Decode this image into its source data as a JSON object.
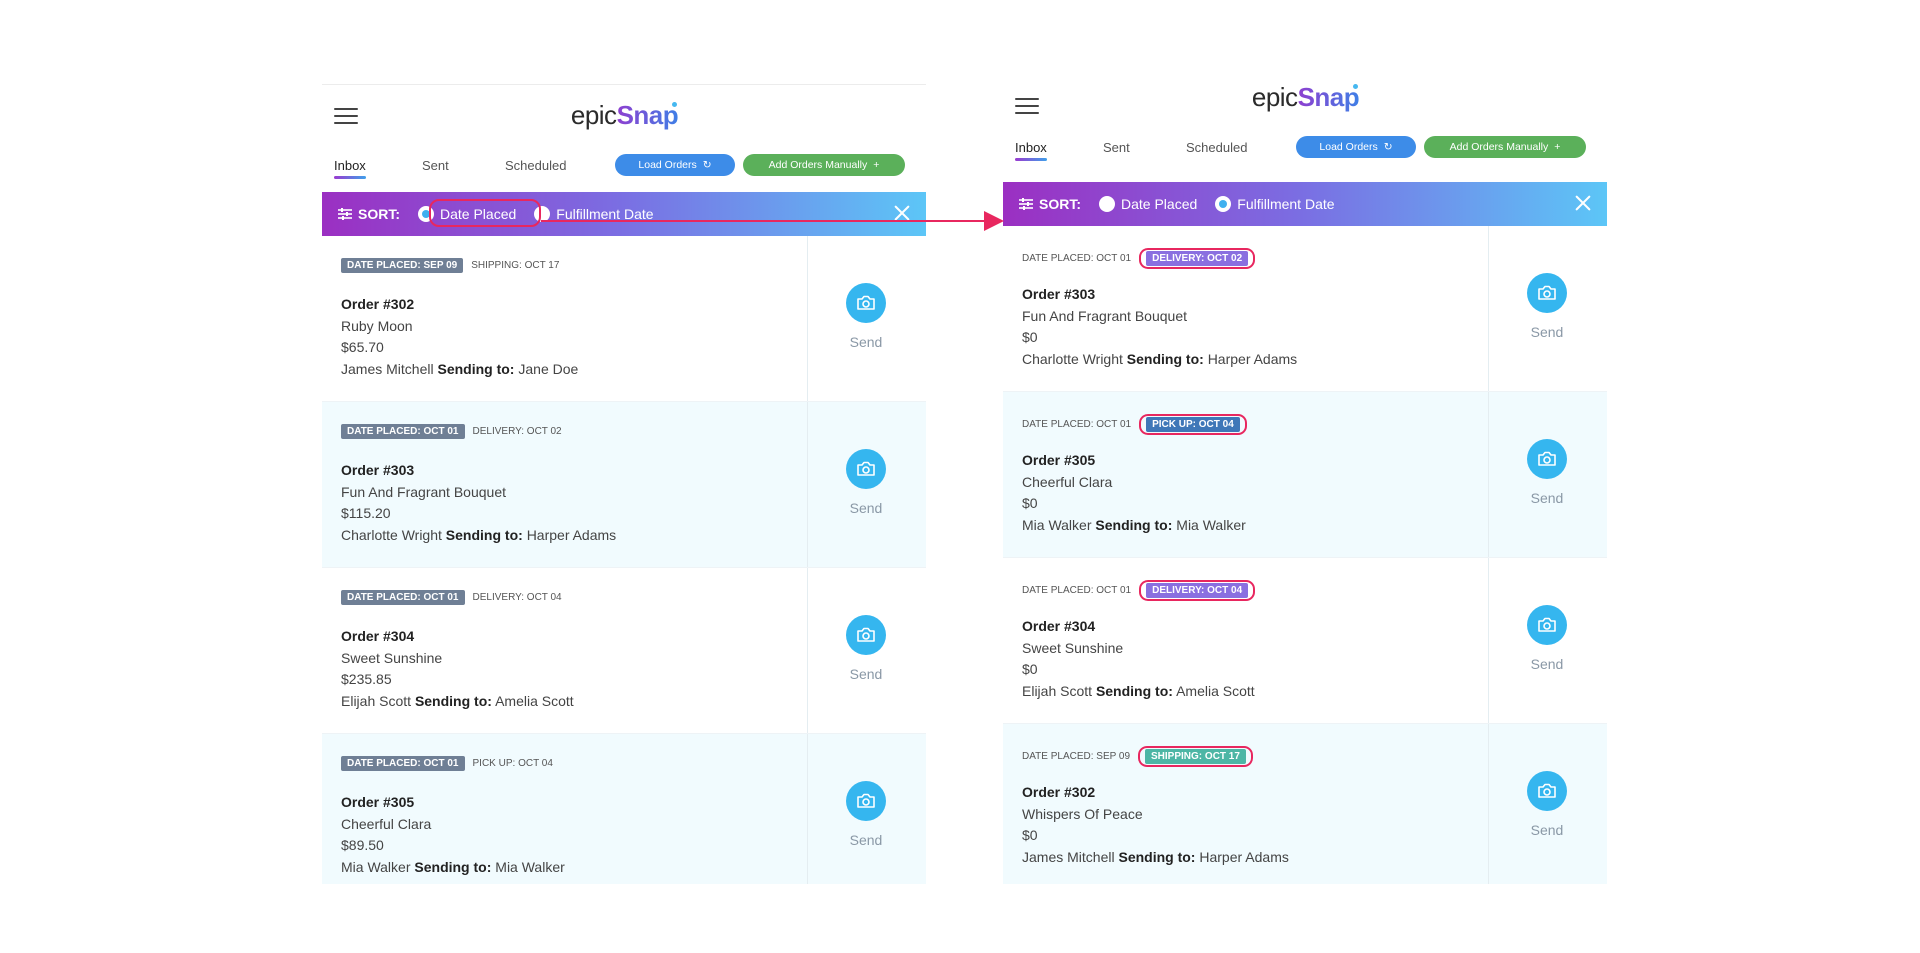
{
  "app": {
    "logo_epic": "epic",
    "logo_snap": "Snap"
  },
  "tabs": [
    {
      "label": "Inbox"
    },
    {
      "label": "Sent"
    },
    {
      "label": "Scheduled"
    }
  ],
  "buttons": {
    "load": "Load Orders",
    "add": "Add Orders Manually"
  },
  "sort": {
    "label": "SORT:",
    "option_date": "Date Placed",
    "option_fulfillment": "Fulfillment Date"
  },
  "send_label": "Send",
  "sending_to_label": "Sending to:",
  "colors": {
    "accent_purple": "#9b2fc2",
    "accent_blue": "#5cc6f7",
    "send_blue": "#35b6ef",
    "highlight": "#e8275f"
  },
  "left_panel": {
    "sort_selected": "date",
    "orders": [
      {
        "placed_badge": "DATE PLACED: SEP 09",
        "fulfillment": "SHIPPING: OCT 17",
        "order_no": "Order #302",
        "product": "Ruby Moon",
        "price": "$65.70",
        "sender": "James Mitchell",
        "recipient": "Jane Doe"
      },
      {
        "placed_badge": "DATE PLACED: OCT 01",
        "fulfillment": "DELIVERY: OCT 02",
        "order_no": "Order #303",
        "product": "Fun And Fragrant Bouquet",
        "price": "$115.20",
        "sender": "Charlotte Wright",
        "recipient": "Harper Adams"
      },
      {
        "placed_badge": "DATE PLACED: OCT 01",
        "fulfillment": "DELIVERY: OCT 04",
        "order_no": "Order #304",
        "product": "Sweet Sunshine",
        "price": "$235.85",
        "sender": "Elijah Scott",
        "recipient": "Amelia Scott"
      },
      {
        "placed_badge": "DATE PLACED: OCT 01",
        "fulfillment": "PICK UP: OCT 04",
        "order_no": "Order #305",
        "product": "Cheerful Clara",
        "price": "$89.50",
        "sender": "Mia Walker",
        "recipient": "Mia Walker"
      }
    ]
  },
  "right_panel": {
    "sort_selected": "fulfillment",
    "orders": [
      {
        "placed": "DATE PLACED: OCT 01",
        "fulfillment_badge": "DELIVERY: OCT 02",
        "badge_color": "purple",
        "order_no": "Order #303",
        "product": "Fun And Fragrant Bouquet",
        "price": "$0",
        "sender": "Charlotte Wright",
        "recipient": "Harper Adams"
      },
      {
        "placed": "DATE PLACED: OCT 01",
        "fulfillment_badge": "PICK UP: OCT 04",
        "badge_color": "blue",
        "order_no": "Order #305",
        "product": "Cheerful Clara",
        "price": "$0",
        "sender": "Mia Walker",
        "recipient": "Mia Walker"
      },
      {
        "placed": "DATE PLACED: OCT 01",
        "fulfillment_badge": "DELIVERY: OCT 04",
        "badge_color": "purple",
        "order_no": "Order #304",
        "product": "Sweet Sunshine",
        "price": "$0",
        "sender": "Elijah Scott",
        "recipient": "Amelia Scott"
      },
      {
        "placed": "DATE PLACED: SEP 09",
        "fulfillment_badge": "SHIPPING: OCT 17",
        "badge_color": "teal",
        "order_no": "Order #302",
        "product": "Whispers Of Peace",
        "price": "$0",
        "sender": "James Mitchell",
        "recipient": "Harper Adams"
      }
    ]
  }
}
